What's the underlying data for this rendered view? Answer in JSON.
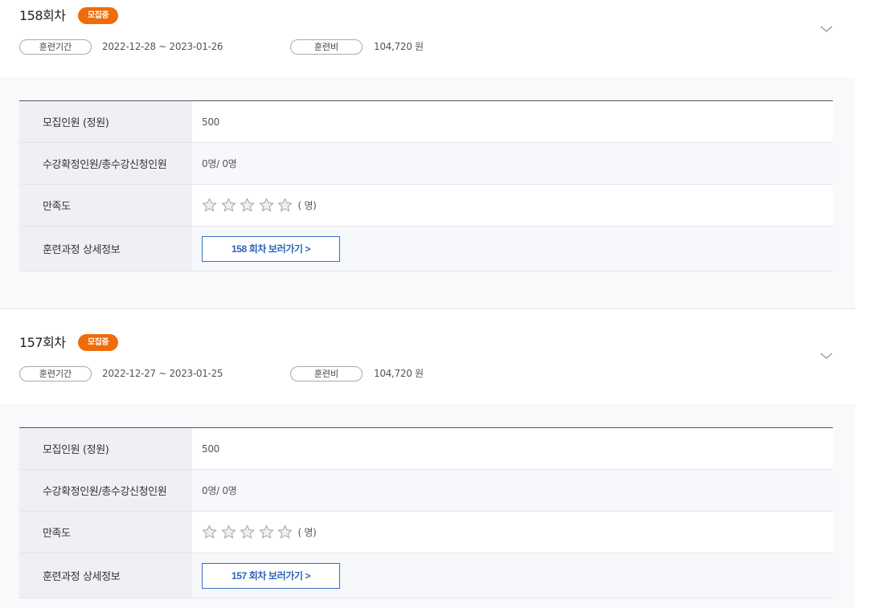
{
  "sessions": [
    {
      "title": "158회차",
      "badge": "모집중",
      "period_label": "훈련기간",
      "period_value": "2022-12-28 ~ 2023-01-26",
      "fee_label": "훈련비",
      "fee_value": "104,720 원",
      "rows": {
        "capacity_label": "모집인원 (정원)",
        "capacity_value": "500",
        "enroll_label": "수강확정인원/총수강신청인원",
        "enroll_value": "0명/ 0명",
        "rating_label": "만족도",
        "rating_count": "( 명)",
        "detail_label": "훈련과정 상세정보",
        "detail_button": "158 회차 보러가기 >"
      }
    },
    {
      "title": "157회차",
      "badge": "모집중",
      "period_label": "훈련기간",
      "period_value": "2022-12-27 ~ 2023-01-25",
      "fee_label": "훈련비",
      "fee_value": "104,720 원",
      "rows": {
        "capacity_label": "모집인원 (정원)",
        "capacity_value": "500",
        "enroll_label": "수강확정인원/총수강신청인원",
        "enroll_value": "0명/ 0명",
        "rating_label": "만족도",
        "rating_count": "( 명)",
        "detail_label": "훈련과정 상세정보",
        "detail_button": "157 회차 보러가기 >"
      }
    }
  ],
  "colors": {
    "badge": "#ef6c0b",
    "button_border": "#3a70c2",
    "button_text": "#2d63b8",
    "header_cell": "#eef0f3"
  },
  "icons": {
    "star": "star-outline-icon",
    "toggle": "chevron-down-icon"
  }
}
